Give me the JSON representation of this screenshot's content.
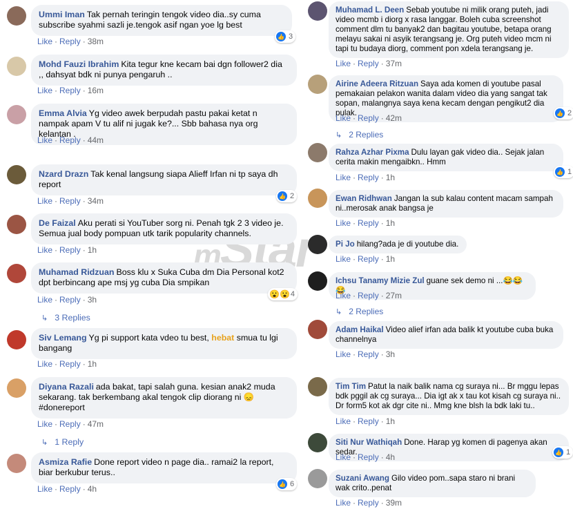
{
  "watermark": {
    "prefix": "m",
    "brand": "Star"
  },
  "left": [
    {
      "author": "Ummi Iman",
      "text": "Tak pernah teringin tengok video dia..sy cuma subscribe syahmi sazli je.tengok asif ngan yoe lg best",
      "time": "38m",
      "reactions": "3",
      "avatar": "#8a6a5a"
    },
    {
      "author": "Mohd Fauzi Ibrahim",
      "text": "Kita tegur kne kecam bai dgn follower2 dia ,, dahsyat bdk ni punya pengaruh ..",
      "time": "16m",
      "avatar": "#d8c8a8"
    },
    {
      "author": "Emma Alvia",
      "text": "Yg video awek berpudah pastu pakai ketat n nampak apam V tu alif ni jugak ke?... Sbb bahasa nya org kelantan .",
      "time": "44m",
      "avatar": "#c9a0a6"
    },
    {
      "author": "Nzard Drazn",
      "text": "Tak kenal langsung siapa Alieff Irfan ni tp saya dh report",
      "time": "34m",
      "reactions": "2",
      "avatar": "#6b5b3a"
    },
    {
      "author": "De Faizal",
      "text": "Aku perati si YouTuber sorg ni. Penah tgk 2 3 video je. Semua jual body pompuan utk tarik popularity channels.",
      "time": "1h",
      "avatar": "#9b5544"
    },
    {
      "author": "Muhamad Ridzuan",
      "text": "Boss klu x Suka Cuba dm Dia Personal kot2 dpt berbincang ape msj yg cuba Dia smpikan",
      "time": "3h",
      "reactions": "4",
      "replies": "3 Replies",
      "avatar": "#b0473a"
    },
    {
      "author": "Siv Lemang",
      "text_before": "Yg pi support kata vdeo tu best, ",
      "highlight": "hebat",
      "text_after": " smua tu lgi bangang",
      "time": "1h",
      "avatar": "#c0392b"
    },
    {
      "author": "Diyana Razali",
      "text": "ada bakat, tapi salah guna. kesian anak2 muda sekarang. tak berkembang akal tengok clip diorang ni 😞 #donereport",
      "time": "47m",
      "replies": "1 Reply",
      "avatar": "#d9a066"
    },
    {
      "author": "Asmiza Rafie",
      "text": "Done report video n page dia.. ramai2 la report, biar berkubur terus..",
      "time": "4h",
      "reactions": "6",
      "avatar": "#c48a7a"
    }
  ],
  "right": [
    {
      "author": "Muhamad L. Deen",
      "text": "Sebab youtube ni milik orang puteh, jadi video mcmb i diorg x rasa langgar. Boleh cuba screenshot comment dlm tu banyak2 dan bagitau youtube, betapa orang melayu sakai ni asyik terangsang je. Org puteh video mcm ni tapi tu budaya diorg, comment pon xdela terangsang je.",
      "time": "37m",
      "avatar": "#5c5470"
    },
    {
      "author": "Airine Adeera Ritzuan",
      "text": "Saya ada komen di youtube pasal pemakaian pelakon wanita dalam video dia yang sangat tak sopan, malangnya saya kena kecam dengan pengikut2 dia pulak.",
      "time": "42m",
      "reactions": "2",
      "replies": "2 Replies",
      "avatar": "#b7a07a"
    },
    {
      "author": "Rahza Azhar Pixma",
      "text": "Dulu layan gak video dia.. Sejak jalan cerita makin mengaibkn.. Hmm",
      "time": "1h",
      "reactions": "1",
      "avatar": "#8c7a6b"
    },
    {
      "author": "Ewan Ridhwan",
      "text": "Jangan la sub kalau content macam sampah ni..merosak anak bangsa je",
      "time": "1h",
      "avatar": "#c8955a"
    },
    {
      "author": "Pi Jo",
      "text": "hilang?ada je di youtube dia.",
      "time": "1h",
      "avatar": "#2b2b2b"
    },
    {
      "author": "Ichsu Tanamy Mizie Zul",
      "text": "guane sek demo ni ...😂😂😂",
      "time": "27m",
      "replies": "2 Replies",
      "avatar": "#1e1e1e"
    },
    {
      "author": "Adam Haikal",
      "text": "Video alief irfan ada balik kt youtube cuba buka channelnya",
      "time": "3h",
      "avatar": "#a04a3a"
    },
    {
      "author": "Tim Tim",
      "text": "Patut la naik balik nama cg suraya ni... Br mggu lepas bdk pggil ak cg suraya... Dia igt ak x tau kot kisah cg suraya ni.. Dr form5 kot ak dgr cite ni.. Mmg kne blsh la bdk laki tu..",
      "time": "1h",
      "avatar": "#7a6a4a"
    },
    {
      "author": "Siti Nur Wathiqah",
      "text": "Done. Harap yg komen di pagenya akan sedar.",
      "time": "4h",
      "reactions": "1",
      "avatar": "#3d4a3a"
    },
    {
      "author": "Suzani Awang",
      "text": "Gilo video pom..sapa staro ni brani wak crito..penat",
      "time": "39m",
      "avatar": "#9a9a9a"
    }
  ],
  "labels": {
    "like": "Like",
    "reply": "Reply"
  }
}
